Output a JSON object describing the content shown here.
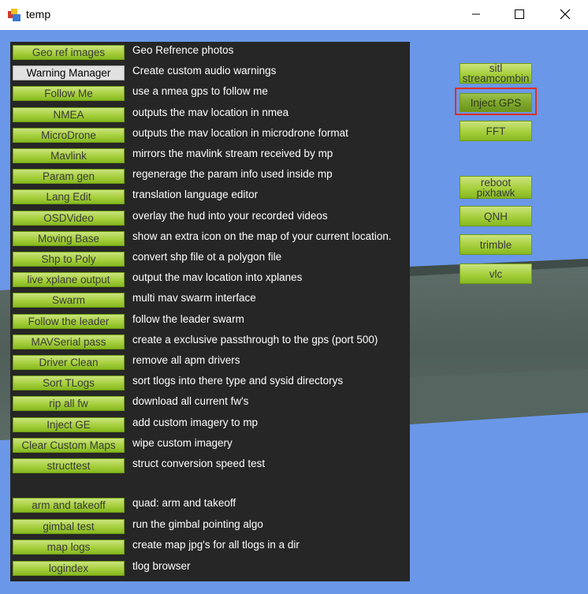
{
  "window": {
    "title": "temp",
    "icon": "app-window-icon",
    "controls": {
      "minimize": "minimize-icon",
      "maximize": "maximize-icon",
      "close": "close-icon"
    }
  },
  "tools": [
    {
      "button": "Geo ref images",
      "description": "Geo Refrence photos"
    },
    {
      "button": "Warning Manager",
      "description": "Create custom audio warnings",
      "focused": true
    },
    {
      "button": "Follow Me",
      "description": "use a nmea gps to follow me"
    },
    {
      "button": "NMEA",
      "description": "outputs the mav location in nmea"
    },
    {
      "button": "MicroDrone",
      "description": "outputs the mav location in microdrone format"
    },
    {
      "button": "Mavlink",
      "description": "mirrors the mavlink stream received by mp"
    },
    {
      "button": "Param gen",
      "description": "regenerage the param info used inside mp"
    },
    {
      "button": "Lang Edit",
      "description": "translation language editor"
    },
    {
      "button": "OSDVideo",
      "description": "overlay the hud into your recorded videos"
    },
    {
      "button": "Moving Base",
      "description": "show an extra icon on the map of your current location."
    },
    {
      "button": "Shp to Poly",
      "description": "convert shp file ot a polygon file"
    },
    {
      "button": "live xplane output",
      "description": "output the mav location into xplanes"
    },
    {
      "button": "Swarm",
      "description": "multi mav swarm interface"
    },
    {
      "button": "Follow the leader",
      "description": "follow the leader swarm"
    },
    {
      "button": "MAVSerial pass",
      "description": "create a exclusive passthrough to the gps (port 500)"
    },
    {
      "button": "Driver Clean",
      "description": "remove all apm drivers"
    },
    {
      "button": "Sort TLogs",
      "description": "sort tlogs into there type and sysid directorys"
    },
    {
      "button": "rip all fw",
      "description": "download all current fw's"
    },
    {
      "button": "Inject GE",
      "description": "add custom imagery to mp"
    },
    {
      "button": "Clear Custom Maps",
      "description": "wipe custom imagery"
    },
    {
      "button": "structtest",
      "description": "struct conversion speed test"
    },
    {
      "button": "arm and takeoff",
      "description": "quad: arm and takeoff"
    },
    {
      "button": "gimbal test",
      "description": "run the gimbal pointing algo"
    },
    {
      "button": "map logs",
      "description": "create map jpg's for all tlogs in a dir"
    },
    {
      "button": "logindex",
      "description": "tlog browser"
    }
  ],
  "side_buttons": [
    {
      "label_line1": "sitl",
      "label_line2": "streamcombin"
    },
    {
      "label_line1": "Inject GPS",
      "label_line2": "",
      "highlighted": true
    },
    {
      "label_line1": "FFT",
      "label_line2": ""
    },
    {
      "label_line1": "reboot",
      "label_line2": "pixhawk"
    },
    {
      "label_line1": "QNH",
      "label_line2": ""
    },
    {
      "label_line1": "trimble",
      "label_line2": ""
    },
    {
      "label_line1": "vlc",
      "label_line2": ""
    }
  ],
  "colors": {
    "sky": "#6a97e8",
    "panel": "#262626",
    "button_green": "#a6cf3c",
    "highlight_border": "#e0301e"
  }
}
